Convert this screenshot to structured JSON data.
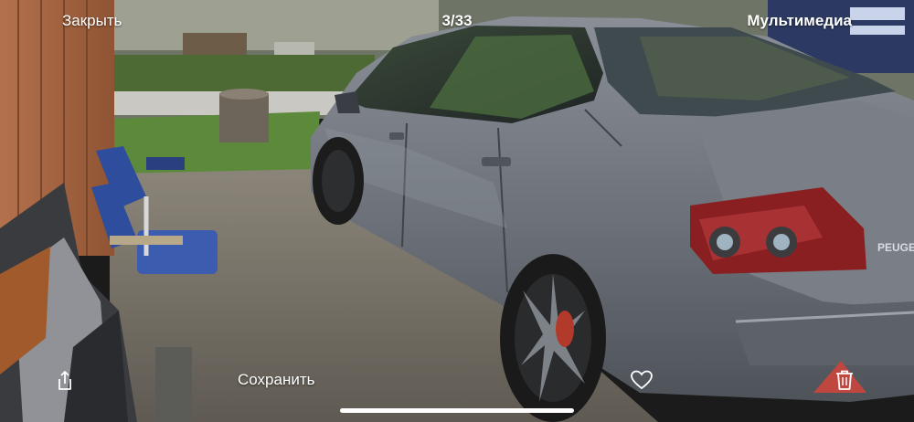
{
  "header": {
    "close_label": "Закрыть",
    "counter": "3/33",
    "media_label": "Мультимедиа"
  },
  "footer": {
    "share_icon": "share-icon",
    "save_label": "Сохранить",
    "favorite_icon": "heart-icon",
    "delete_icon": "trash-icon"
  },
  "photo": {
    "badge_text": "PEUGEOT"
  },
  "colors": {
    "car_body": "#6f747c",
    "foreground_text": "#ffffff"
  }
}
